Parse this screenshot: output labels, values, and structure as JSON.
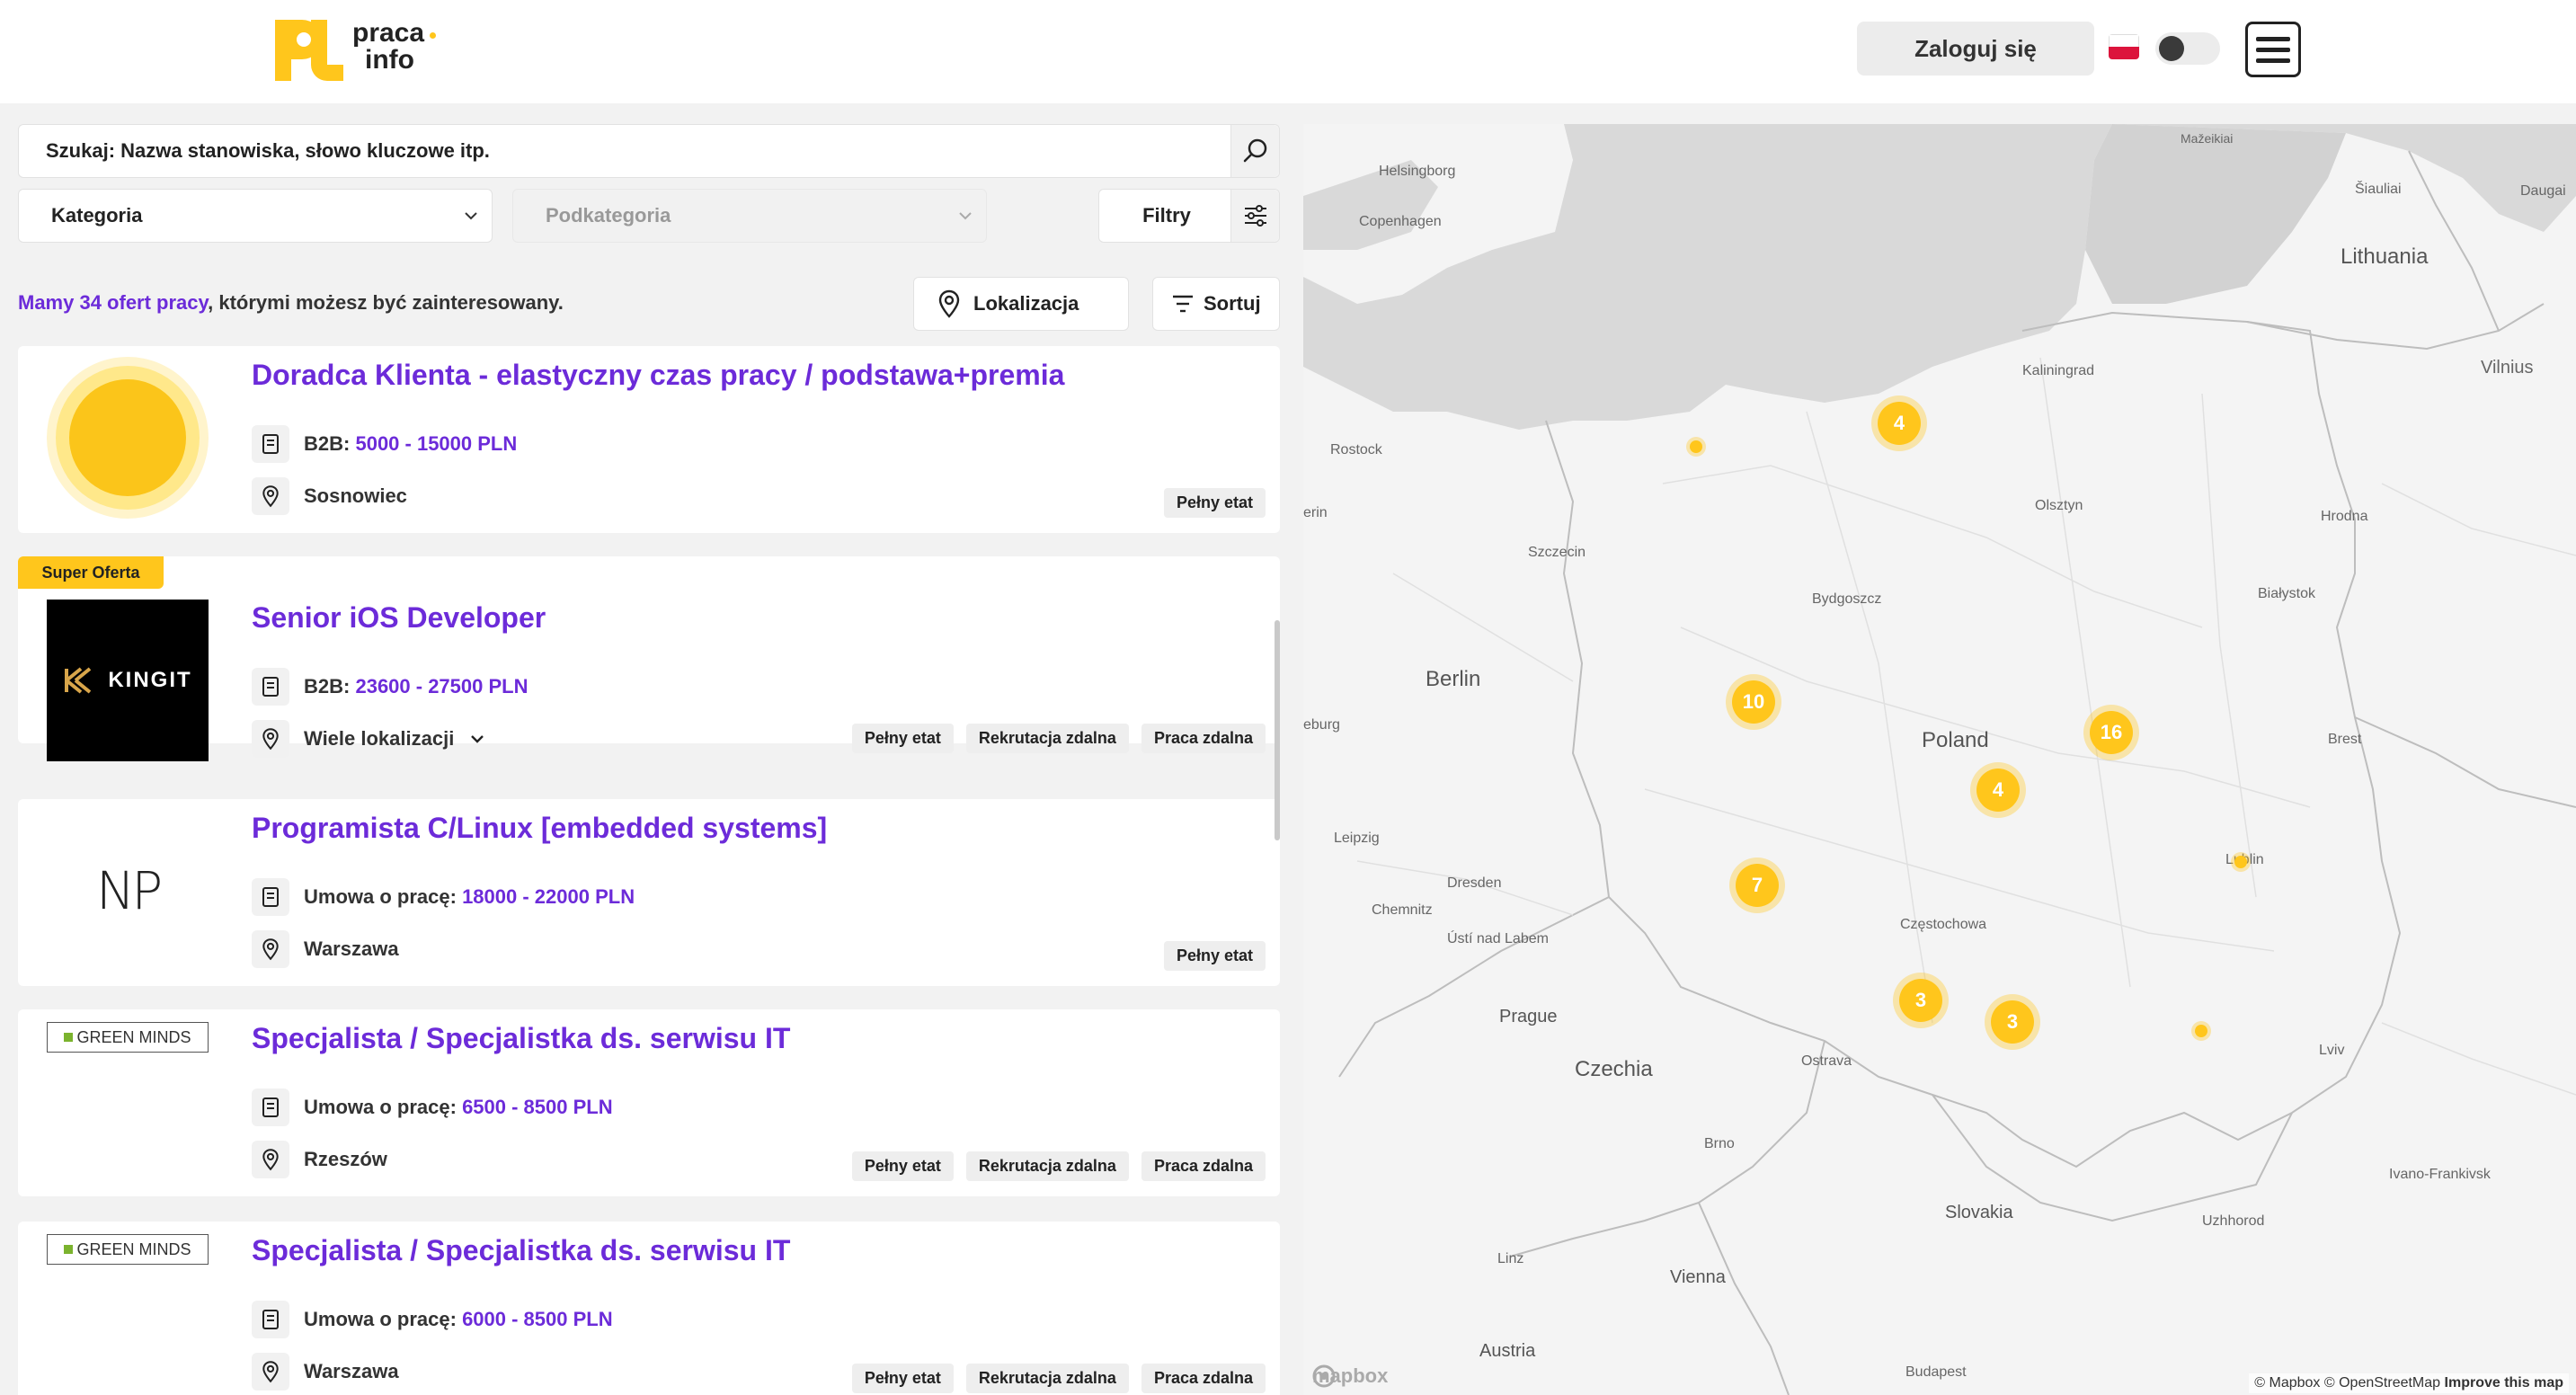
{
  "header": {
    "logo_line1": "praca",
    "logo_line2": "info",
    "login_label": "Zaloguj się"
  },
  "search": {
    "placeholder": "Szukaj: Nazwa stanowiska, słowo kluczowe itp."
  },
  "filters": {
    "category": "Kategoria",
    "subcategory": "Podkategoria",
    "filters_label": "Filtry",
    "location_label": "Lokalizacja",
    "sort_label": "Sortuj"
  },
  "summary": {
    "highlight": "Mamy 34 ofert pracy",
    "rest": ", którymi możesz być zainteresowany."
  },
  "offers": [
    {
      "title": "Doradca Klienta - elastyczny czas pracy / podstawa+premia",
      "salary_type": "B2B:",
      "salary": "5000 - 15000 PLN",
      "location": "Sosnowiec",
      "tags": [
        "Pełny etat"
      ]
    },
    {
      "badge": "Super Oferta",
      "company_logo_text": "KINGIT",
      "title": "Senior iOS Developer",
      "salary_type": "B2B:",
      "salary": "23600 - 27500 PLN",
      "location": "Wiele lokalizacji",
      "tags": [
        "Pełny etat",
        "Rekrutacja zdalna",
        "Praca zdalna"
      ]
    },
    {
      "company_logo_text": "NP",
      "title": "Programista C/Linux [embedded systems]",
      "salary_type": "Umowa o pracę:",
      "salary": "18000 - 22000 PLN",
      "location": "Warszawa",
      "tags": [
        "Pełny etat"
      ]
    },
    {
      "company_logo_text": "GREEN MINDS",
      "title": "Specjalista / Specjalistka ds. serwisu IT",
      "salary_type": "Umowa o pracę:",
      "salary": "6500 - 8500 PLN",
      "location": "Rzeszów",
      "tags": [
        "Pełny etat",
        "Rekrutacja zdalna",
        "Praca zdalna"
      ]
    },
    {
      "company_logo_text": "GREEN MINDS",
      "title": "Specjalista / Specjalistka ds. serwisu IT",
      "salary_type": "Umowa o pracę:",
      "salary": "6000 - 8500 PLN",
      "location": "Warszawa",
      "tags": [
        "Pełny etat",
        "Rekrutacja zdalna",
        "Praca zdalna"
      ]
    }
  ],
  "map": {
    "countries": [
      "Poland",
      "Lithuania",
      "Czechia",
      "Slovakia",
      "Austria"
    ],
    "cities": [
      "Helsingborg",
      "Copenhagen",
      "Rostock",
      "Berlin",
      "Leipzig",
      "Dresden",
      "Chemnitz",
      "Ústí nad Labem",
      "Prague",
      "Brno",
      "Linz",
      "Vienna",
      "Budapest",
      "Szczecin",
      "Bydgoszcz",
      "Kaliningrad",
      "Olsztyn",
      "Białystok",
      "Hrodna",
      "Vilnius",
      "Šiauliai",
      "Daugai",
      "Mažeikiai",
      "Brest",
      "Lublin",
      "Lviv",
      "Ivano-Frankivsk",
      "Uzhhorod",
      "Ostrava",
      "Częstochowa",
      "erin",
      "eburg"
    ],
    "clusters": [
      "4",
      "10",
      "16",
      "4",
      "7",
      "3",
      "3"
    ],
    "attribution": "© Mapbox © OpenStreetMap",
    "improve": "Improve this map",
    "mapbox": "mapbox"
  },
  "colors": {
    "accent": "#6c2bd9",
    "brand_yellow": "#ffc61c"
  }
}
